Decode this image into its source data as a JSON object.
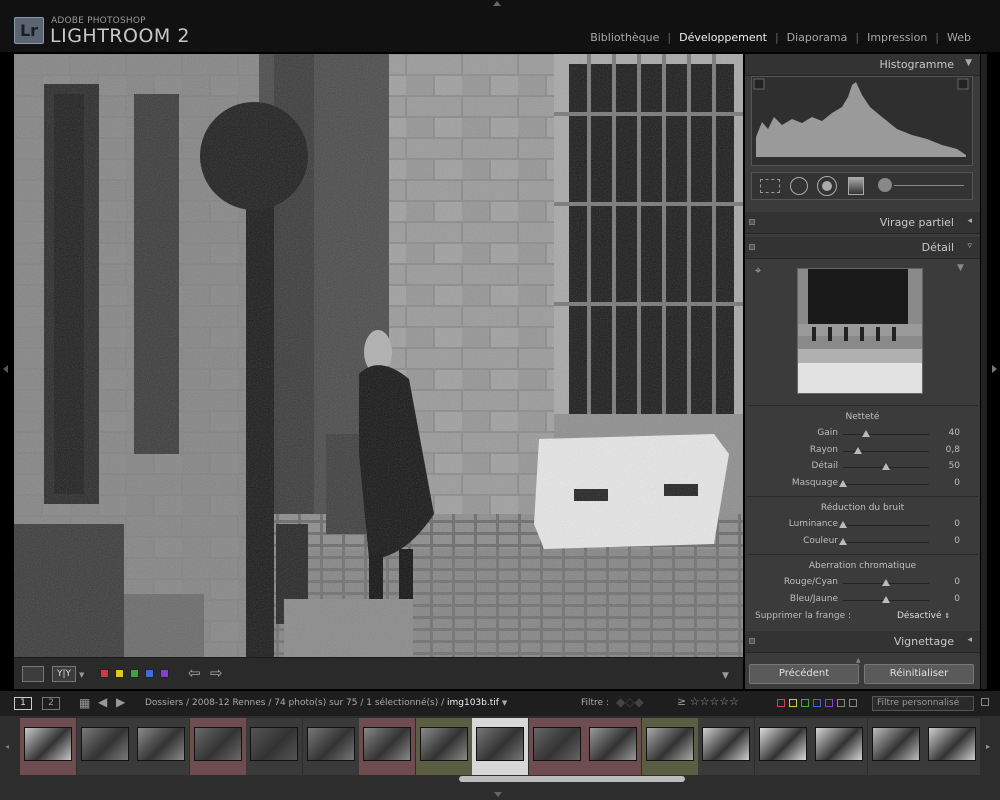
{
  "app": {
    "logo": "Lr",
    "brand_top": "ADOBE PHOTOSHOP",
    "brand_main": "LIGHTROOM 2"
  },
  "modules": [
    {
      "label": "Bibliothèque",
      "active": false
    },
    {
      "label": "Développement",
      "active": true
    },
    {
      "label": "Diaporama",
      "active": false
    },
    {
      "label": "Impression",
      "active": false
    },
    {
      "label": "Web",
      "active": false
    }
  ],
  "panels": {
    "histogram": "Histogramme",
    "split_toning": "Virage partiel",
    "detail": "Détail",
    "vignetting": "Vignettage"
  },
  "detail": {
    "sharpening": {
      "title": "Netteté",
      "sliders": [
        {
          "label": "Gain",
          "value": "40",
          "pos": 0.27
        },
        {
          "label": "Rayon",
          "value": "0,8",
          "pos": 0.18
        },
        {
          "label": "Détail",
          "value": "50",
          "pos": 0.5
        },
        {
          "label": "Masquage",
          "value": "0",
          "pos": 0.0
        }
      ]
    },
    "noise": {
      "title": "Réduction du bruit",
      "sliders": [
        {
          "label": "Luminance",
          "value": "0",
          "pos": 0.0
        },
        {
          "label": "Couleur",
          "value": "0",
          "pos": 0.0
        }
      ]
    },
    "chromatic": {
      "title": "Aberration chromatique",
      "sliders": [
        {
          "label": "Rouge/Cyan",
          "value": "0",
          "pos": 0.5
        },
        {
          "label": "Bleu/Jaune",
          "value": "0",
          "pos": 0.5
        }
      ],
      "fringe_label": "Supprimer la frange :",
      "fringe_value": "Désactivé"
    }
  },
  "buttons": {
    "previous": "Précédent",
    "reset": "Réinitialiser"
  },
  "filmstrip_bar": {
    "page1": "1",
    "page2": "2",
    "path": "Dossiers / 2008-12 Rennes / 74 photo(s) sur 75 / 1 sélectionné(s) /",
    "filename": "img103b.tif",
    "filter_label": "Filtre :",
    "filter_preset": "Filtre personnalisé"
  },
  "color_labels": [
    "#d23a3a",
    "#d8c72e",
    "#3aa53a",
    "#3a6fd8",
    "#8a3ad8"
  ],
  "filmstrip": {
    "thumbs": [
      {
        "bg": "#6e4c50",
        "tone": "#c8c8c8"
      },
      {
        "bg": "#3a3a3a",
        "tone": "#7a7a7a"
      },
      {
        "bg": "#3a3a3a",
        "tone": "#8a8a8a"
      },
      {
        "bg": "#6e4c50",
        "tone": "#6a6a6a"
      },
      {
        "bg": "#3a3a3a",
        "tone": "#555555"
      },
      {
        "bg": "#3a3a3a",
        "tone": "#777777"
      },
      {
        "bg": "#6e4c50",
        "tone": "#888888"
      },
      {
        "bg": "#5c5e44",
        "tone": "#8a8a8a"
      },
      {
        "bg": "#d8d8d8",
        "tone": "#777777"
      },
      {
        "bg": "#6e4c50",
        "tone": "#666666"
      },
      {
        "bg": "#6e4c50",
        "tone": "#999999"
      },
      {
        "bg": "#5c5e44",
        "tone": "#aaaaaa"
      },
      {
        "bg": "#3a3a3a",
        "tone": "#cfcfcf"
      },
      {
        "bg": "#3a3a3a",
        "tone": "#dcdcdc"
      },
      {
        "bg": "#3a3a3a",
        "tone": "#d5d5d5"
      },
      {
        "bg": "#3a3a3a",
        "tone": "#bdbdbd"
      },
      {
        "bg": "#3a3a3a",
        "tone": "#cfcfcf"
      }
    ]
  }
}
